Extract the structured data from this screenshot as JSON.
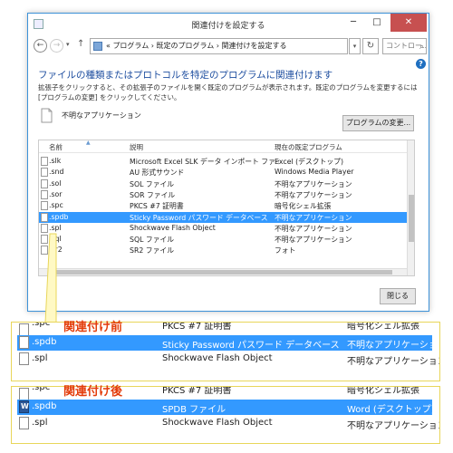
{
  "window": {
    "title": "関連付けを設定する",
    "controls": {
      "minimize": "─",
      "maximize": "□",
      "close": "✕"
    }
  },
  "nav": {
    "back": "←",
    "forward": "→",
    "up": "↑",
    "breadcrumb": "« プログラム › 既定のプログラム › 関連付けを設定する",
    "refresh": "↻",
    "search_placeholder": "コントロー..."
  },
  "content": {
    "heading": "ファイルの種類またはプロトコルを特定のプログラムに関連付けます",
    "description": "拡張子をクリックすると、その拡張子のファイルを開く既定のプログラムが表示されます。既定のプログラムを変更するには [プログラムの変更] をクリックしてください。",
    "current_program": "不明なアプリケーション",
    "change_button": "プログラムの変更...",
    "close_button": "閉じる"
  },
  "list": {
    "headers": {
      "name": "名前",
      "description": "説明",
      "current": "現在の既定プログラム"
    },
    "rows": [
      {
        "name": ".slk",
        "description": "Microsoft Excel SLK データ インポート ファイル",
        "current": "Excel (デスクトップ)"
      },
      {
        "name": ".snd",
        "description": "AU 形式サウンド",
        "current": "Windows Media Player"
      },
      {
        "name": ".sol",
        "description": "SOL ファイル",
        "current": "不明なアプリケーション"
      },
      {
        "name": ".sor",
        "description": "SOR ファイル",
        "current": "不明なアプリケーション"
      },
      {
        "name": ".spc",
        "description": "PKCS #7 証明書",
        "current": "暗号化シェル拡張"
      },
      {
        "name": ".spdb",
        "description": "Sticky Password パスワード データベース",
        "current": "不明なアプリケーション",
        "selected": true
      },
      {
        "name": ".spl",
        "description": "Shockwave Flash Object",
        "current": "不明なアプリケーション"
      },
      {
        "name": ".sql",
        "description": "SQL ファイル",
        "current": "不明なアプリケーション"
      },
      {
        "name": ".sr2",
        "description": "SR2 ファイル",
        "current": "フォト"
      }
    ]
  },
  "before": {
    "label": "関連付け前",
    "rows": [
      {
        "name": ".spc",
        "description": "PKCS #7 証明書",
        "current": "暗号化シェル拡張"
      },
      {
        "name": ".spdb",
        "description": "Sticky Password パスワード データベース",
        "current": "不明なアプリケーション",
        "selected": true
      },
      {
        "name": ".spl",
        "description": "Shockwave Flash Object",
        "current": "不明なアプリケーション"
      }
    ]
  },
  "after": {
    "label": "関連付け後",
    "rows": [
      {
        "name": ".spc",
        "description": "PKCS #7 証明書",
        "current": "暗号化シェル拡張"
      },
      {
        "name": ".spdb",
        "description": "SPDB ファイル",
        "current": "Word (デスクトップ)",
        "selected": true
      },
      {
        "name": ".spl",
        "description": "Shockwave Flash Object",
        "current": "不明なアプリケーション"
      }
    ]
  },
  "colors": {
    "accent": "#3399ff",
    "heading": "#1f4fa0",
    "callout": "#e33c0a",
    "panel_border": "#e8d65a"
  }
}
